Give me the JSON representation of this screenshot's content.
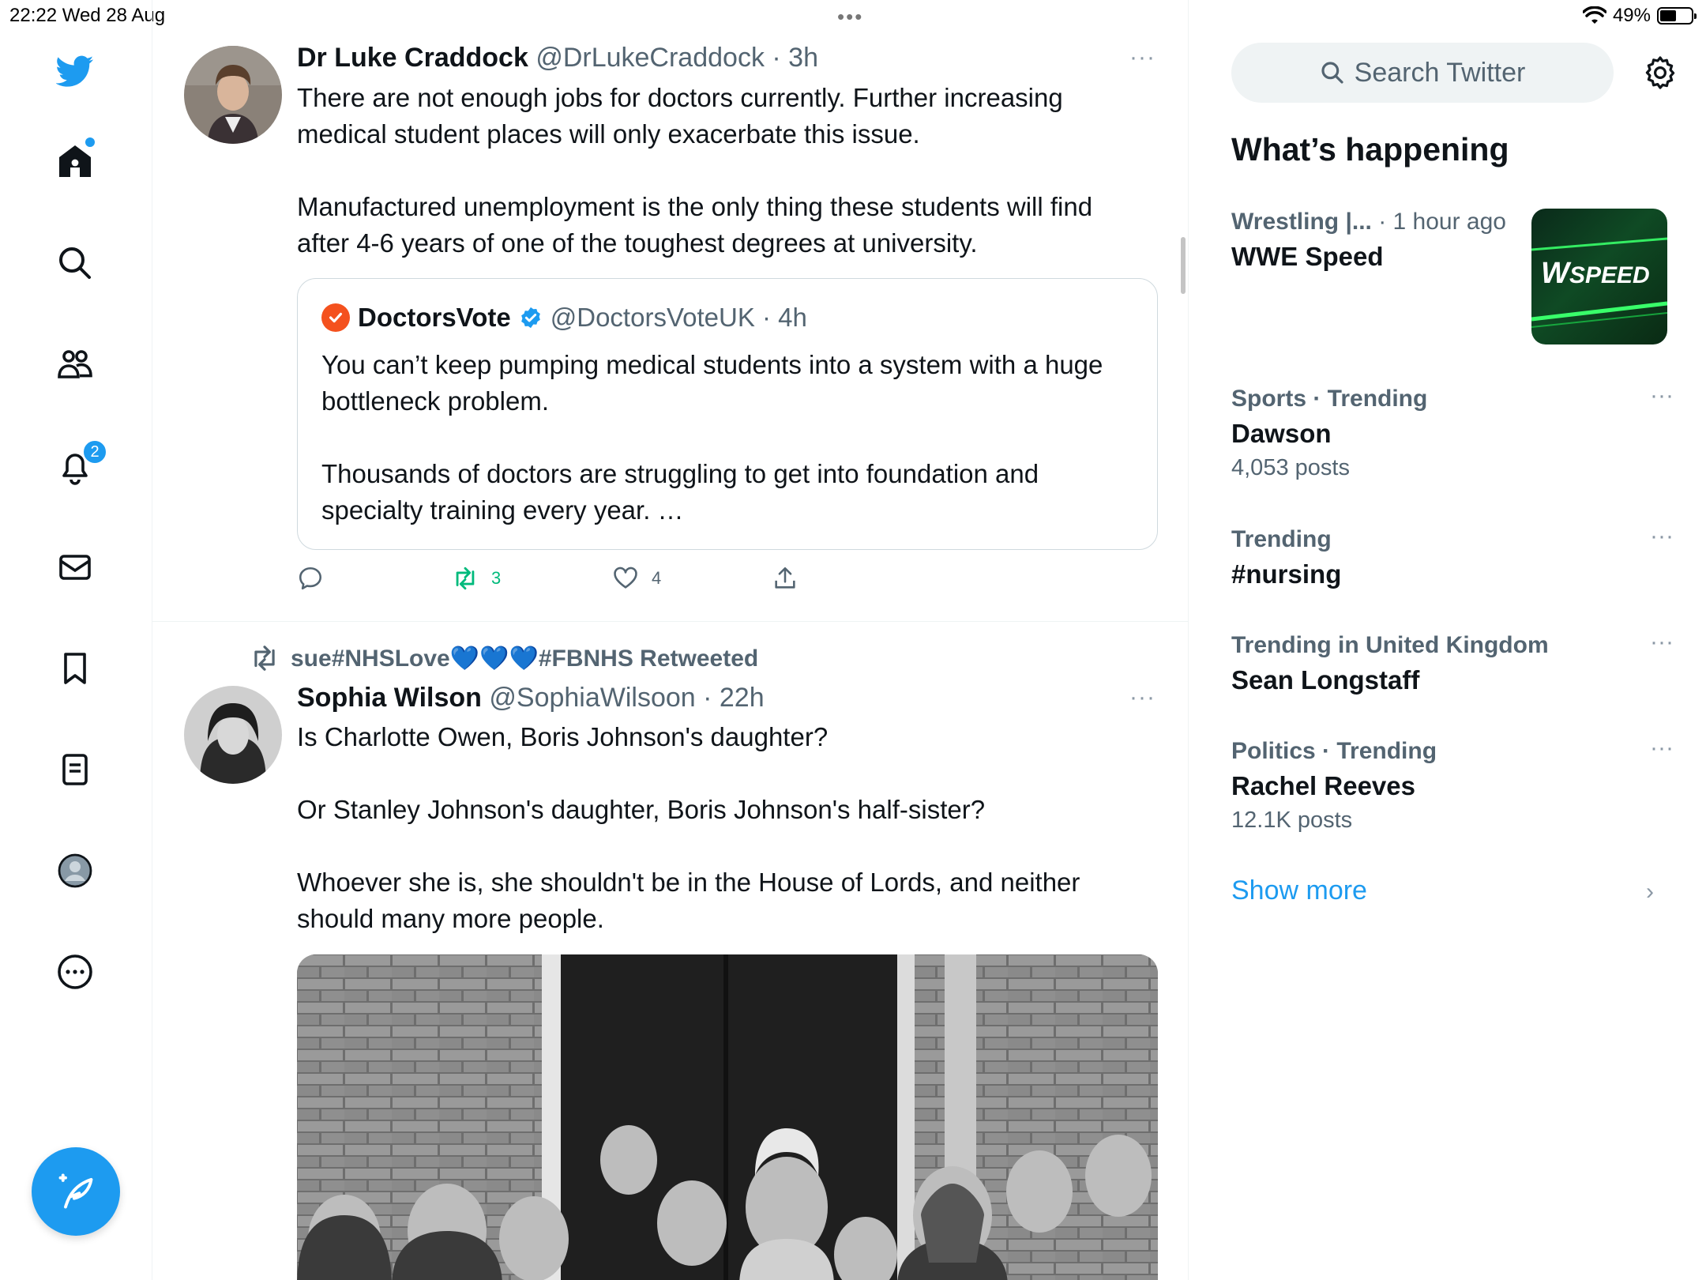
{
  "status_bar": {
    "time_date": "22:22  Wed 28 Aug",
    "battery": "49%"
  },
  "nav": {
    "notifications_badge": "2"
  },
  "tweets": [
    {
      "name": "Dr Luke Craddock",
      "handle": "@DrLukeCraddock · 3h",
      "more": "···",
      "paragraphs": [
        "There are not enough jobs for doctors currently. Further increasing medical student places will only exacerbate this issue.",
        "Manufactured unemployment is the only thing these students will find after 4-6 years of one of the toughest degrees at university."
      ],
      "quote": {
        "name": "DoctorsVote",
        "handle": "@DoctorsVoteUK · 4h",
        "paragraphs": [
          "You can’t keep pumping medical students into a system with a huge bottleneck problem.",
          "Thousands of doctors are struggling to get into foundation and specialty training every year. …"
        ]
      },
      "actions": {
        "retweets": "3",
        "likes": "4"
      }
    },
    {
      "retweeted_by_prefix": "sue#NHSLove",
      "retweeted_hearts": "💙💙💙",
      "retweeted_by_suffix": "#FBNHS Retweeted",
      "name": "Sophia Wilson",
      "handle": "@SophiaWilsoon · 22h",
      "more": "···",
      "paragraphs": [
        "Is Charlotte Owen, Boris Johnson's daughter?",
        "Or Stanley Johnson's daughter, Boris Johnson's half-sister?",
        "Whoever she is, she shouldn't be in the House of Lords, and neither should many more people."
      ]
    }
  ],
  "sidebar": {
    "search_placeholder": "Search Twitter",
    "title": "What’s happening",
    "trends": [
      {
        "meta": "Wrestling |...",
        "meta_light": " · 1 hour ago",
        "name": "WWE Speed",
        "count": "",
        "image_text": "SPEED"
      },
      {
        "meta": "Sports · Trending",
        "name": "Dawson",
        "count": "4,053 posts"
      },
      {
        "meta": "Trending",
        "name": "#nursing",
        "count": ""
      },
      {
        "meta": "Trending in United Kingdom",
        "name": "Sean Longstaff",
        "count": ""
      },
      {
        "meta": "Politics · Trending",
        "name": "Rachel Reeves",
        "count": "12.1K posts"
      }
    ],
    "more_glyph": "···",
    "show_more": "Show more"
  },
  "colors": {
    "accent": "#1d9bf0",
    "retweet_green": "#00ba7c",
    "muted": "#536471"
  }
}
